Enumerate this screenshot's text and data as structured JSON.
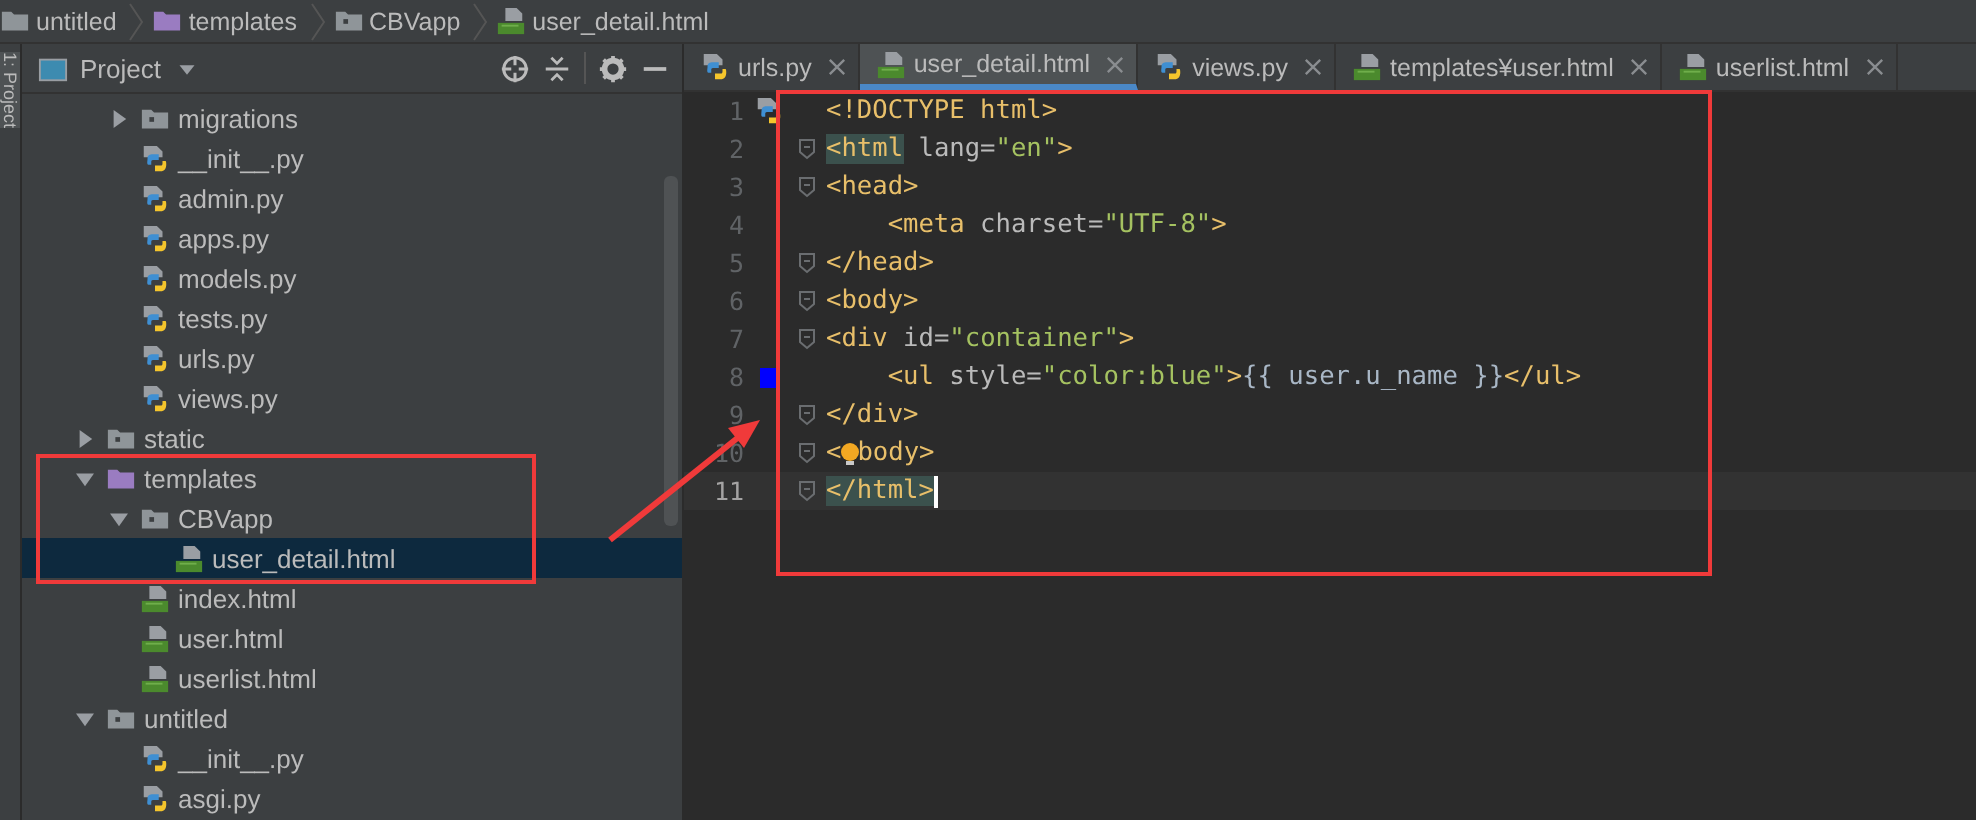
{
  "breadcrumb": [
    {
      "label": "untitled",
      "kind": "folder"
    },
    {
      "label": "templates",
      "kind": "template_folder"
    },
    {
      "label": "CBVapp",
      "kind": "package"
    },
    {
      "label": "user_detail.html",
      "kind": "html"
    }
  ],
  "tool_strip": {
    "label": "1: Project"
  },
  "project_panel": {
    "title": "Project",
    "tree": [
      {
        "children": [
          {
            "label": "migrations",
            "kind": "package",
            "expanded": false,
            "selected": false
          },
          {
            "label": "__init__.py",
            "kind": "python",
            "selected": false
          },
          {
            "label": "admin.py",
            "kind": "python",
            "selected": false
          },
          {
            "label": "apps.py",
            "kind": "python",
            "selected": false
          },
          {
            "label": "models.py",
            "kind": "python",
            "selected": false
          },
          {
            "label": "tests.py",
            "kind": "python",
            "selected": false
          },
          {
            "label": "urls.py",
            "kind": "python",
            "selected": false
          },
          {
            "label": "views.py",
            "kind": "python",
            "selected": false
          }
        ]
      },
      {
        "label": "static",
        "kind": "package",
        "expanded": false,
        "selected": false
      },
      {
        "label": "templates",
        "kind": "template_folder",
        "expanded": true,
        "selected": false,
        "children": [
          {
            "label": "CBVapp",
            "kind": "package",
            "expanded": true,
            "selected": false,
            "children": [
              {
                "label": "user_detail.html",
                "kind": "html",
                "selected": true
              }
            ]
          },
          {
            "label": "index.html",
            "kind": "html",
            "selected": false
          },
          {
            "label": "user.html",
            "kind": "html",
            "selected": false
          },
          {
            "label": "userlist.html",
            "kind": "html",
            "selected": false
          }
        ]
      },
      {
        "label": "untitled",
        "kind": "package",
        "expanded": true,
        "selected": false,
        "children": [
          {
            "label": "__init__.py",
            "kind": "python",
            "selected": false
          },
          {
            "label": "asgi.py",
            "kind": "python",
            "selected": false
          }
        ]
      }
    ]
  },
  "tabs": [
    {
      "label": "urls.py",
      "kind": "python",
      "selected": false
    },
    {
      "label": "user_detail.html",
      "kind": "html",
      "selected": true
    },
    {
      "label": "views.py",
      "kind": "python",
      "selected": false
    },
    {
      "label": "templates¥user.html",
      "kind": "html",
      "selected": false
    },
    {
      "label": "userlist.html",
      "kind": "html",
      "selected": false
    }
  ],
  "editor": {
    "lines": [
      {
        "number": "1",
        "kind": "python_marker",
        "fold": false,
        "current": false,
        "tokens": [
          {
            "kind": "tag",
            "text": "<!DOCTYPE html>"
          }
        ]
      },
      {
        "number": "2",
        "kind": "plain",
        "fold": true,
        "current": false,
        "tokens": [
          {
            "kind": "tag",
            "text": "<html",
            "highlight": true
          },
          {
            "kind": "attr",
            "text": " lang="
          },
          {
            "kind": "value",
            "text": "\"en\""
          },
          {
            "kind": "tag",
            "text": ">"
          }
        ]
      },
      {
        "number": "3",
        "kind": "plain",
        "fold": true,
        "current": false,
        "tokens": [
          {
            "kind": "tag",
            "text": "<head"
          },
          {
            "kind": "tag",
            "text": ">"
          }
        ]
      },
      {
        "number": "4",
        "kind": "plain",
        "fold": false,
        "current": false,
        "tokens": [
          {
            "kind": "tag",
            "text": "    <meta"
          },
          {
            "kind": "attr",
            "text": " charset="
          },
          {
            "kind": "value",
            "text": "\"UTF-8\""
          },
          {
            "kind": "tag",
            "text": ">"
          }
        ]
      },
      {
        "number": "5",
        "kind": "plain",
        "fold": true,
        "current": false,
        "tokens": [
          {
            "kind": "tag",
            "text": "</head>"
          }
        ]
      },
      {
        "number": "6",
        "kind": "plain",
        "fold": true,
        "current": false,
        "tokens": [
          {
            "kind": "tag",
            "text": "<body>"
          }
        ]
      },
      {
        "number": "7",
        "kind": "plain",
        "fold": true,
        "current": false,
        "tokens": [
          {
            "kind": "tag",
            "text": "<div"
          },
          {
            "kind": "attr",
            "text": " id="
          },
          {
            "kind": "value",
            "text": "\"container\""
          },
          {
            "kind": "tag",
            "text": ">"
          }
        ]
      },
      {
        "number": "8",
        "kind": "color_swatch",
        "fold": false,
        "current": false,
        "color": "#0000ff",
        "tokens": [
          {
            "kind": "tag",
            "text": "    <ul"
          },
          {
            "kind": "attr",
            "text": " style="
          },
          {
            "kind": "value",
            "text": "\"color:blue\""
          },
          {
            "kind": "tag",
            "text": ">"
          },
          {
            "kind": "text",
            "text": "{{ user.u_name }}"
          },
          {
            "kind": "tag",
            "text": "</ul>"
          }
        ]
      },
      {
        "number": "9",
        "kind": "plain",
        "fold": true,
        "current": false,
        "tokens": [
          {
            "kind": "tag",
            "text": "</div>"
          }
        ]
      },
      {
        "number": "10",
        "kind": "plain",
        "fold": true,
        "current": false,
        "tokens": [
          {
            "kind": "tag",
            "text": "<"
          },
          {
            "kind": "bulb"
          },
          {
            "kind": "tag",
            "text": "body>"
          }
        ]
      },
      {
        "number": "11",
        "kind": "plain",
        "fold": true,
        "current": true,
        "tokens": [
          {
            "kind": "tag",
            "text": "</html>",
            "highlight": true
          }
        ]
      }
    ]
  }
}
